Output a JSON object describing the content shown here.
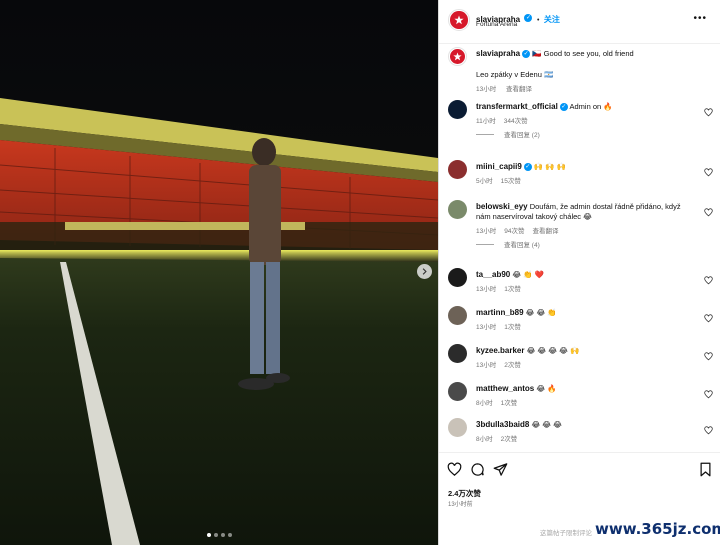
{
  "header": {
    "username": "slaviapraha",
    "follow_label": "关注",
    "location": "Fortuna Arena",
    "more_icon": "more-icon",
    "separator": "•"
  },
  "caption": {
    "username": "slaviapraha",
    "text": "🇨🇿 Good to see you, old friend",
    "text2": "Leo zpátky v Edenu 🇦🇷",
    "time": "13小时",
    "translate": "查看翻译"
  },
  "comments": [
    {
      "user": "transfermarkt_official",
      "verified": true,
      "text": "Admin on 🔥",
      "time": "11小时",
      "likes": "344次赞",
      "replies": "查看回复 (2)",
      "avatar_color": "#0b1c33"
    },
    {
      "user": "miini_capii9",
      "verified": true,
      "text": "🙌 🙌 🙌",
      "time": "5小时",
      "likes": "15次赞",
      "replies": "",
      "avatar_color": "#8b2e2e"
    },
    {
      "user": "belowski_eyy",
      "verified": false,
      "text": "Doufám, že admin dostal řádně přidáno, když nám naservíroval takový chálec 😂",
      "time": "13小时",
      "likes": "94次赞",
      "translate": "查看翻译",
      "replies": "查看回复 (4)",
      "avatar_color": "#7a8a6a"
    },
    {
      "user": "ta__ab90",
      "verified": false,
      "text": "😂 👏 ❤️",
      "time": "13小时",
      "likes": "1次赞",
      "replies": "",
      "avatar_color": "#1a1a1a"
    },
    {
      "user": "martinn_b89",
      "verified": false,
      "text": "😂 😂 👏",
      "time": "13小时",
      "likes": "1次赞",
      "replies": "",
      "avatar_color": "#6d6257"
    },
    {
      "user": "kyzee.barker",
      "verified": false,
      "text": "😂 😂 😂 😂 🙌",
      "time": "13小时",
      "likes": "2次赞",
      "replies": "",
      "avatar_color": "#2b2b2b"
    },
    {
      "user": "matthew_antos",
      "verified": false,
      "text": "😂 🔥",
      "time": "8小时",
      "likes": "1次赞",
      "replies": "",
      "avatar_color": "#4a4a4a"
    },
    {
      "user": "3bdulla3baid8",
      "verified": false,
      "text": "😂 😂 😂",
      "time": "8小时",
      "likes": "2次赞",
      "replies": "",
      "avatar_color": "#c9c2b8"
    }
  ],
  "footer": {
    "likes": "2.4万次赞",
    "time": "13小时前",
    "comments_disabled": "这篇帖子限制评论"
  },
  "watermark": "www.365jz.com",
  "colors": {
    "accent": "#0095f6",
    "brand": "#d6182a"
  }
}
